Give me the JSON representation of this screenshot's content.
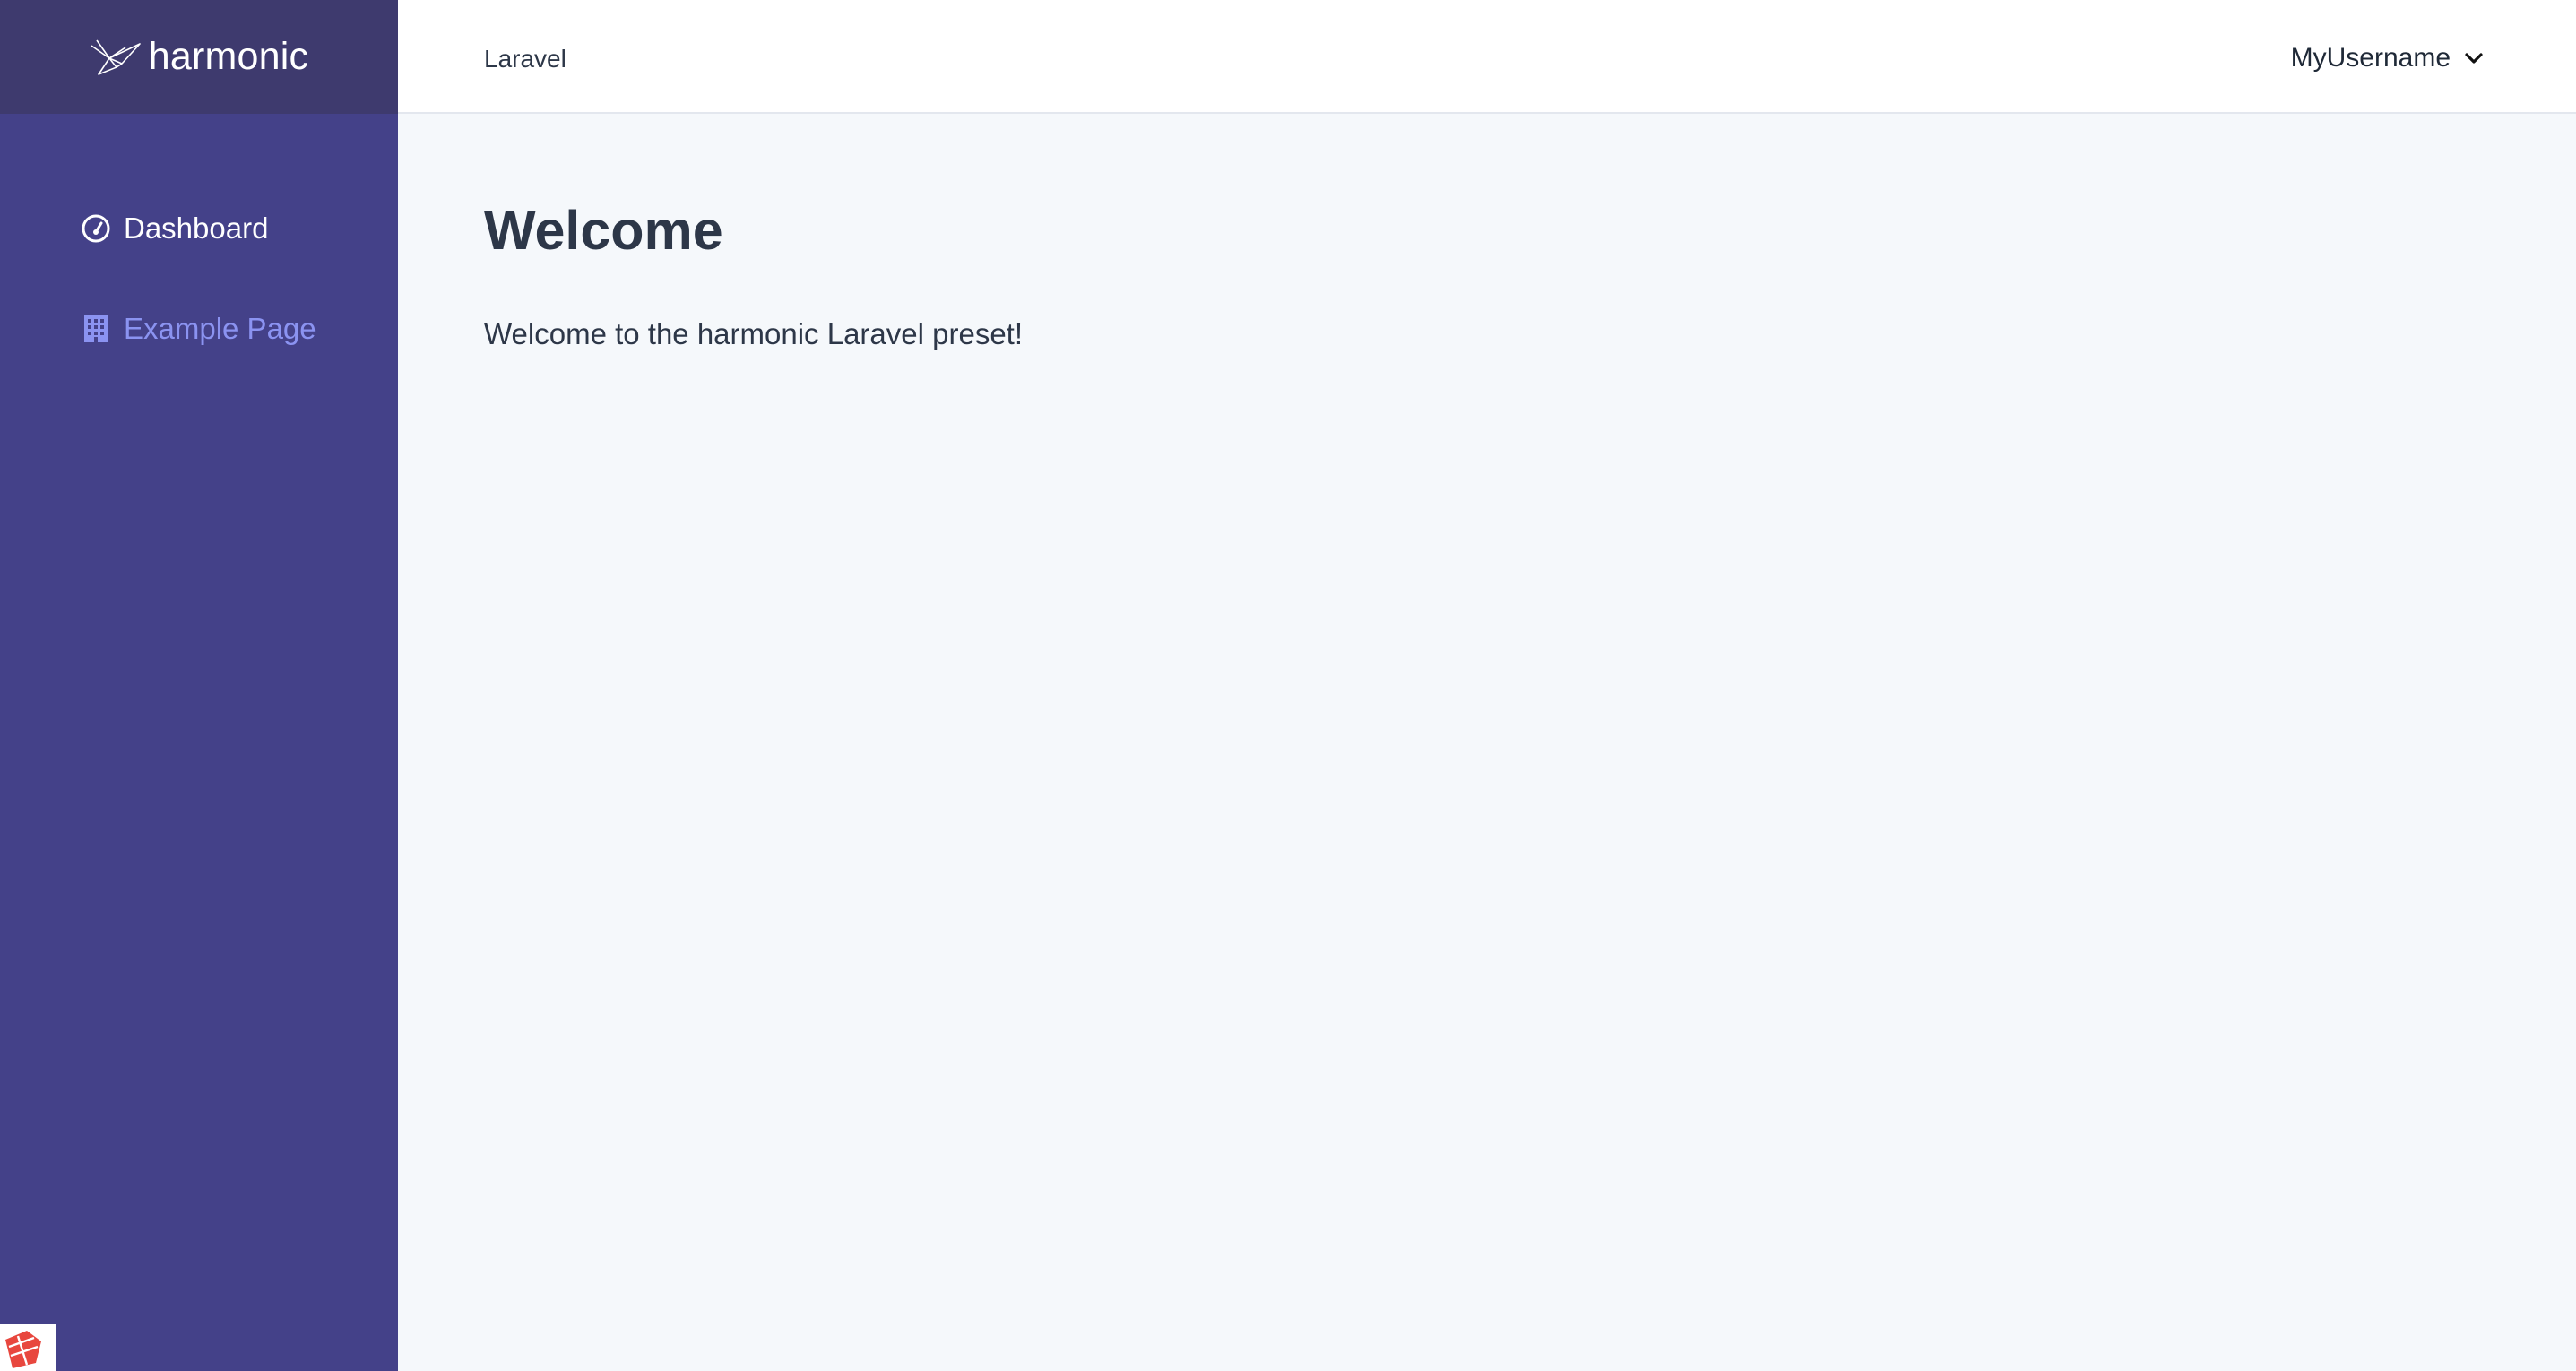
{
  "brand": {
    "name": "harmonic",
    "logo_icon": "origami-bird-icon"
  },
  "sidebar": {
    "items": [
      {
        "label": "Dashboard",
        "icon": "speedometer-icon",
        "color": "#ffffff"
      },
      {
        "label": "Example Page",
        "icon": "building-icon",
        "color": "#8b93f1"
      }
    ]
  },
  "header": {
    "title": "Laravel",
    "user": {
      "name": "MyUsername",
      "icon": "chevron-down-icon"
    }
  },
  "main": {
    "title": "Welcome",
    "text": "Welcome to the harmonic Laravel preset!"
  },
  "colors": {
    "sidebar_bg": "#444189",
    "brand_bg": "#3e3a6e",
    "main_bg": "#f5f8fb",
    "text": "#2d3748",
    "accent": "#8b93f1",
    "corner_badge": "#e8473e"
  }
}
